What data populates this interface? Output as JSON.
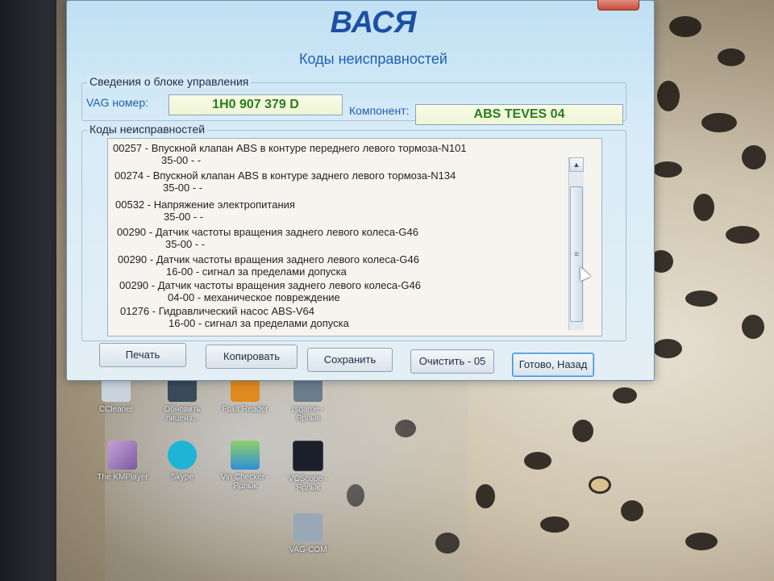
{
  "window": {
    "app_title": "ВАСЯ",
    "subtitle": "Коды неисправностей"
  },
  "control_unit": {
    "group_label": "Сведения о блоке управления",
    "vag_label": "VAG номер:",
    "vag_value": "1H0 907 379 D",
    "component_label": "Компонент:",
    "component_value": "ABS TEVES 04"
  },
  "faults": {
    "group_label": "Коды неисправностей",
    "items": [
      {
        "line": "00257 - Впускной клапан ABS в контуре переднего левого тормоза-N101",
        "detail": "35-00 -  -"
      },
      {
        "line": "00274 - Впускной клапан ABS в контуре заднего левого тормоза-N134",
        "detail": "35-00 -  -"
      },
      {
        "line": "00532 - Напряжение электропитания",
        "detail": "35-00 -  -"
      },
      {
        "line": "00290 - Датчик частоты вращения заднего левого колеса-G46",
        "detail": "35-00 -  -"
      },
      {
        "line": "00290 - Датчик частоты вращения заднего левого колеса-G46",
        "detail": "16-00 - сигнал за пределами допуска"
      },
      {
        "line": "00290 - Датчик частоты вращения заднего левого колеса-G46",
        "detail": "04-00 - механическое повреждение"
      },
      {
        "line": "01276 - Гидравлический насос ABS-V64",
        "detail": "16-00 - сигнал за пределами допуска"
      }
    ]
  },
  "buttons": {
    "print": "Печать",
    "copy": "Копировать",
    "save": "Сохранить",
    "clear": "Очистить - 05",
    "done": "Готово, Назад"
  },
  "desktop_icons": [
    {
      "label": "CCleaner"
    },
    {
      "label": "Обновить лиценз..."
    },
    {
      "label": "Foxit Reader"
    },
    {
      "label": "rsgame - Ярлык"
    },
    {
      "label": "The KMPlayer"
    },
    {
      "label": "Skype"
    },
    {
      "label": "Vin Checker - Ярлык"
    },
    {
      "label": "VCScope - Ярлык"
    },
    {
      "label": "VAG-COM"
    }
  ],
  "colors": {
    "title_blue": "#1d4fa3",
    "field_value_green": "#2a7d1c",
    "window_bg": "#d8ecf7"
  }
}
